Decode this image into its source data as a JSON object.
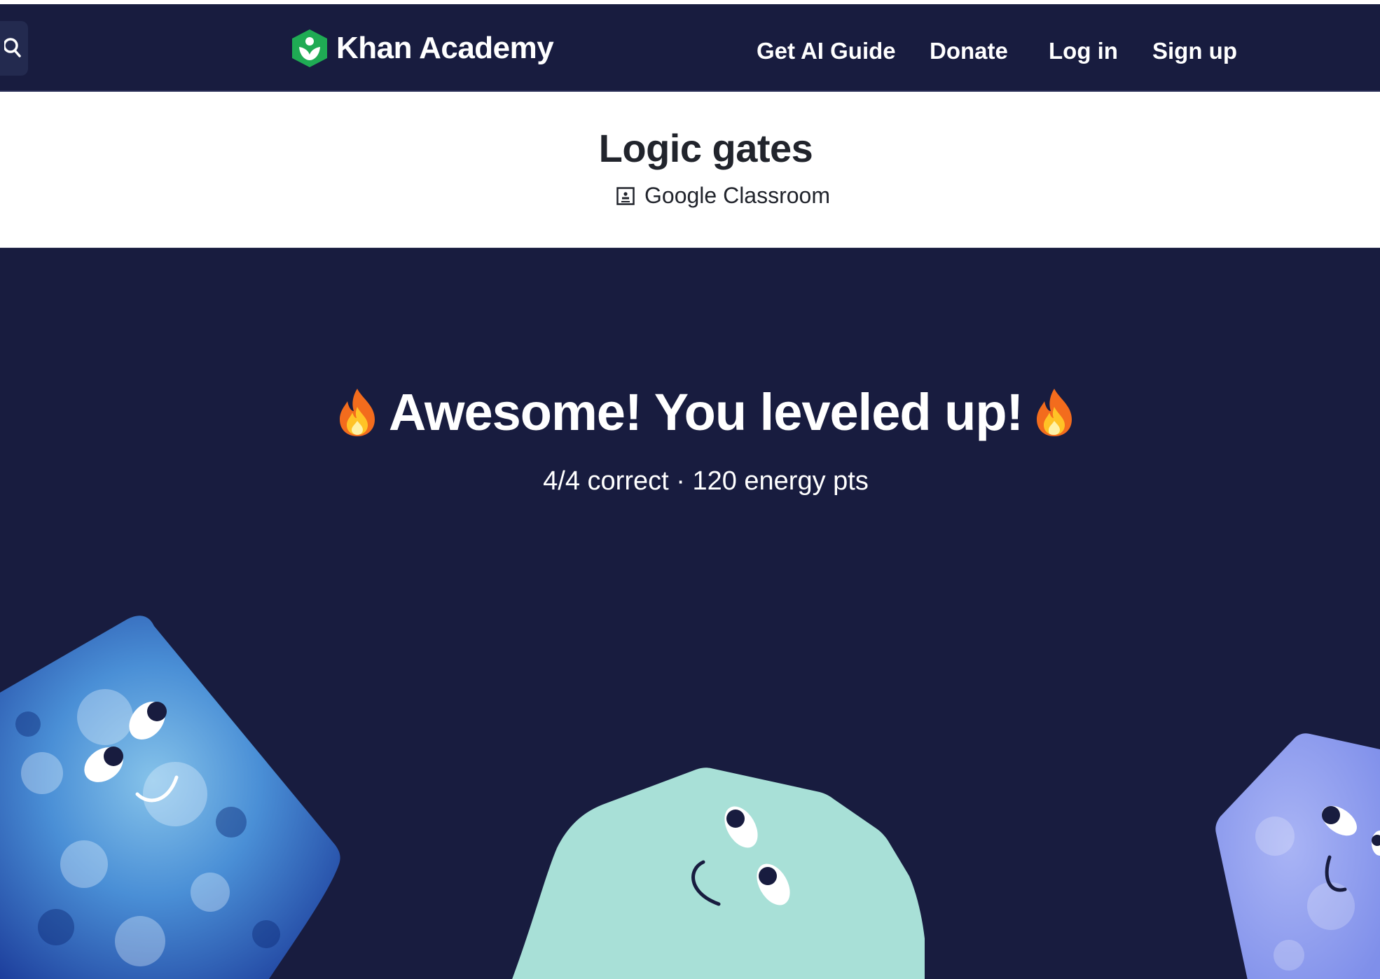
{
  "header": {
    "brand": "Khan Academy",
    "nav": {
      "ai_guide": "Get AI Guide",
      "donate": "Donate",
      "login": "Log in",
      "signup": "Sign up"
    }
  },
  "title_bar": {
    "title": "Logic gates",
    "classroom_label": "Google Classroom"
  },
  "celebration": {
    "headline": "Awesome! You leveled up!",
    "score_text": "4/4 correct · 120 energy pts"
  },
  "icons": {
    "search": "search-icon",
    "logo": "khan-academy-logo-icon",
    "classroom": "google-classroom-icon",
    "fire": "fire-emoji-icon"
  },
  "colors": {
    "navy": "#181c3f",
    "brand_green": "#1fab54",
    "critter_teal": "#a8e0d7",
    "critter_blue": "#2b55b5",
    "critter_periwinkle": "#8d9bf0"
  }
}
